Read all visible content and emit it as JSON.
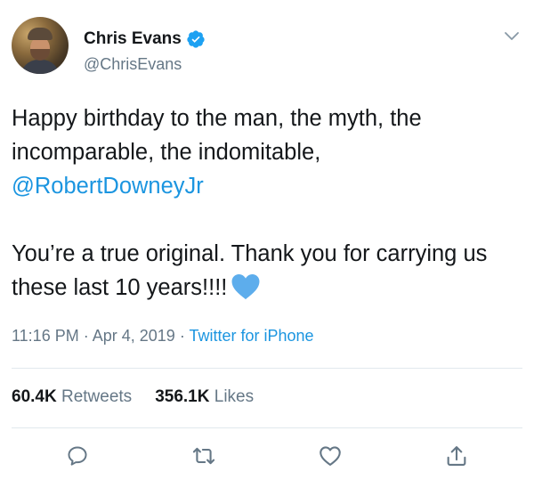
{
  "user": {
    "display_name": "Chris Evans",
    "handle": "@ChrisEvans",
    "verified": true
  },
  "tweet": {
    "line1": "Happy birthday to the man, the myth, the incomparable, the indomitable,",
    "mention": "@RobertDowneyJr",
    "line2": "You’re a true original. Thank you for carrying us these last 10 years!!!!",
    "emoji": "blue-heart"
  },
  "meta": {
    "time": "11:16 PM",
    "separator1": " · ",
    "date": "Apr 4, 2019",
    "separator2": " · ",
    "source": "Twitter for iPhone"
  },
  "stats": {
    "retweets_count": "60.4K",
    "retweets_label": "Retweets",
    "likes_count": "356.1K",
    "likes_label": "Likes"
  },
  "icons": {
    "verified": "verified-badge-icon",
    "menu": "chevron-down-icon",
    "reply": "reply-icon",
    "retweet": "retweet-icon",
    "like": "like-icon",
    "share": "share-icon"
  },
  "colors": {
    "link": "#1b95e0",
    "secondary_text": "#657786",
    "primary_text": "#14171a",
    "heart": "#5dadec"
  }
}
